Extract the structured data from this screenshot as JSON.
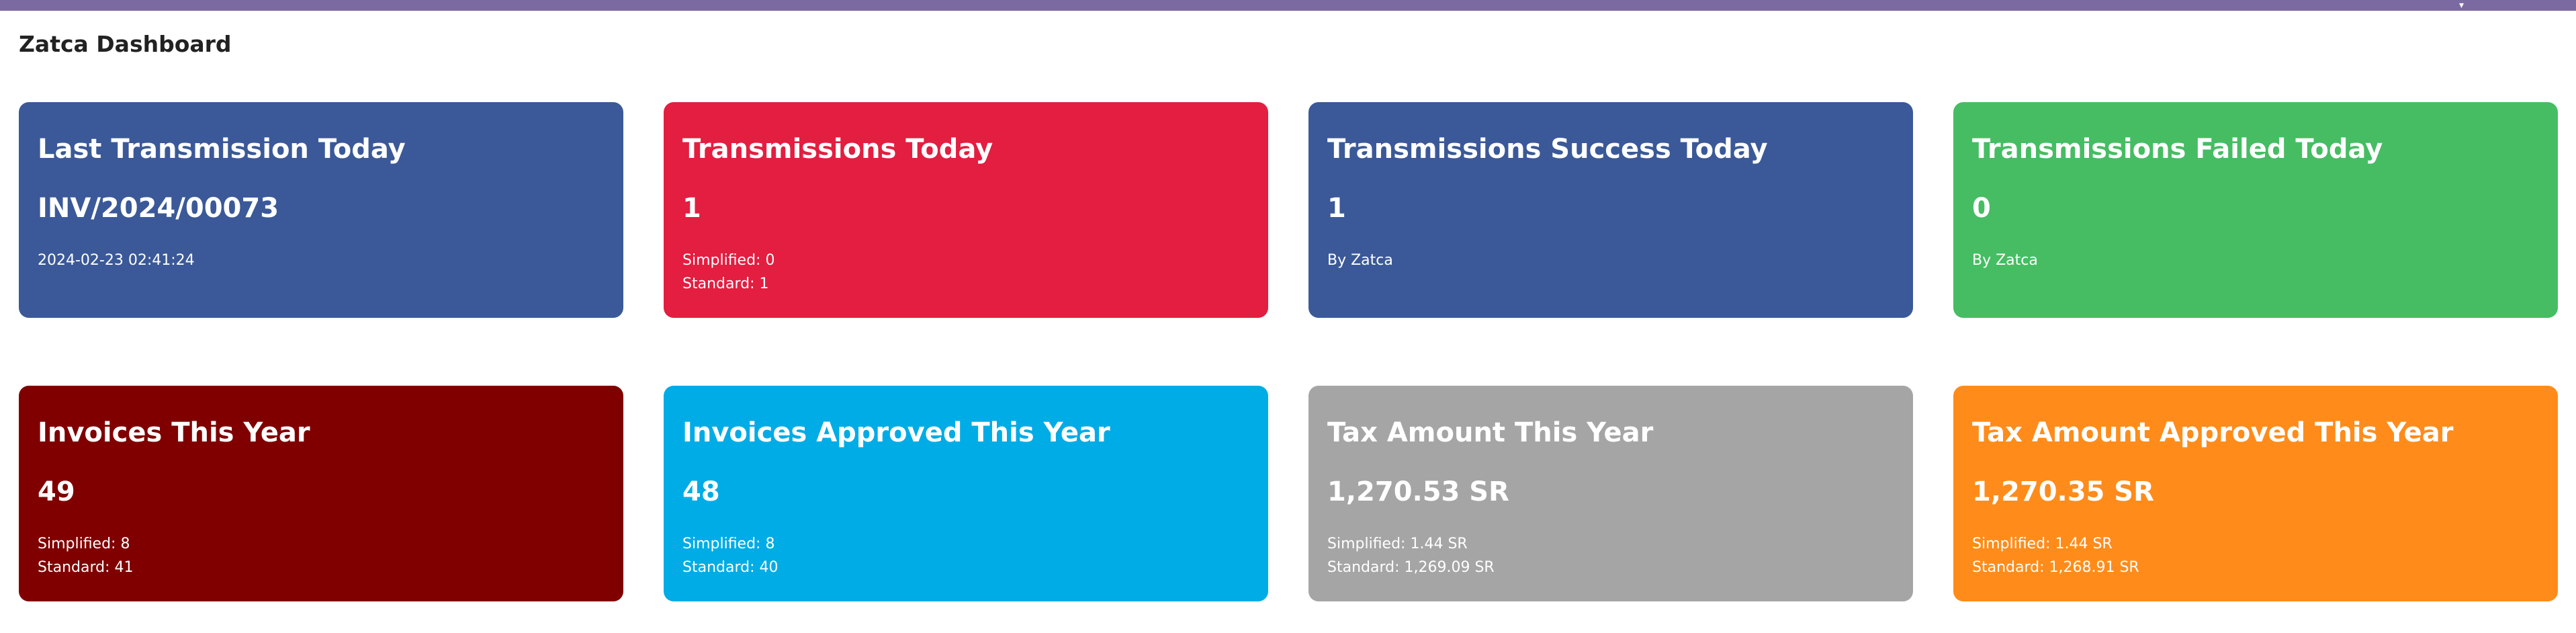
{
  "header": {
    "title": "Zatca Dashboard"
  },
  "theme": {
    "topbar_color": "#7b6aa1"
  },
  "cards": [
    {
      "title": "Last Transmission Today",
      "value": "INV/2024/00073",
      "lines": [
        "2024-02-23 02:41:24"
      ],
      "color": "#3b5998"
    },
    {
      "title": "Transmissions Today",
      "value": "1",
      "lines": [
        "Simplified: 0",
        "Standard: 1"
      ],
      "color": "#e31e40"
    },
    {
      "title": "Transmissions Success Today",
      "value": "1",
      "lines": [
        "By Zatca"
      ],
      "color": "#3b5998"
    },
    {
      "title": "Transmissions Failed Today",
      "value": "0",
      "lines": [
        "By Zatca"
      ],
      "color": "#46bd63"
    },
    {
      "title": "Invoices This Year",
      "value": "49",
      "lines": [
        "Simplified: 8",
        "Standard: 41"
      ],
      "color": "#800000"
    },
    {
      "title": "Invoices Approved This Year",
      "value": "48",
      "lines": [
        "Simplified: 8",
        "Standard: 40"
      ],
      "color": "#00ace6"
    },
    {
      "title": "Tax Amount This Year",
      "value": "1,270.53 SR",
      "lines": [
        "Simplified: 1.44 SR",
        "Standard: 1,269.09 SR"
      ],
      "color": "#a5a5a5"
    },
    {
      "title": "Tax Amount Approved This Year",
      "value": "1,270.35 SR",
      "lines": [
        "Simplified: 1.44 SR",
        "Standard: 1,268.91 SR"
      ],
      "color": "#ff8c1a"
    }
  ]
}
